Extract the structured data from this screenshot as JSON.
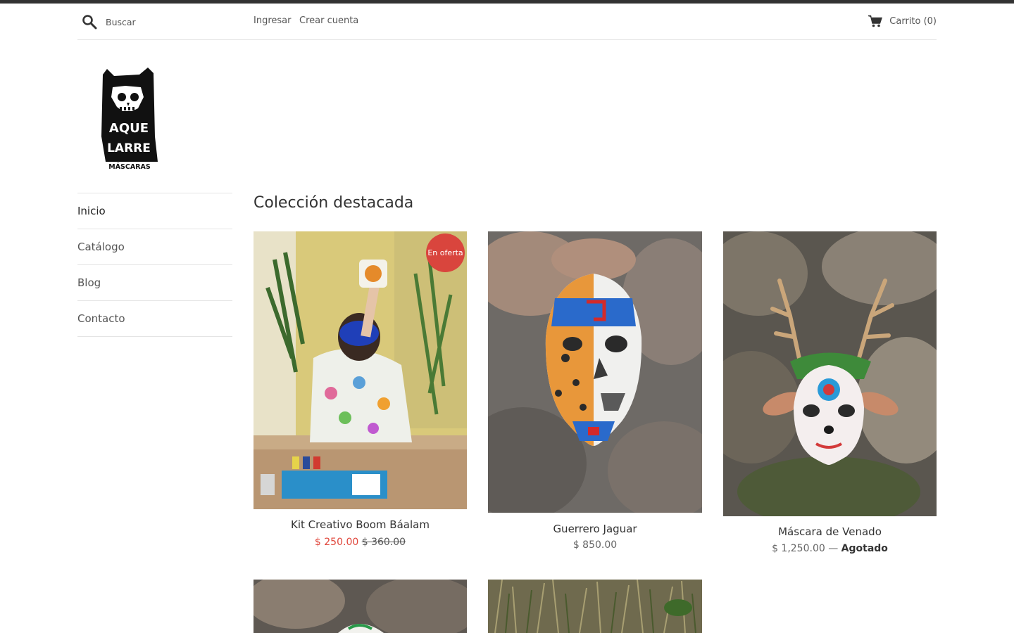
{
  "header": {
    "search_placeholder": "Buscar",
    "login_label": "Ingresar",
    "register_label": "Crear cuenta",
    "cart_label": "Carrito (0)"
  },
  "logo": {
    "icon": "aquelarre-skull-cat-logo",
    "text_line1": "AQUE",
    "text_line2": "LARRE",
    "text_line3": "MÁSCARAS"
  },
  "nav": {
    "items": [
      {
        "label": "Inicio",
        "active": true
      },
      {
        "label": "Catálogo"
      },
      {
        "label": "Blog"
      },
      {
        "label": "Contacto"
      }
    ]
  },
  "collection": {
    "title": "Colección destacada",
    "products": [
      {
        "title": "Kit Creativo Boom Báalam",
        "price": "$ 250.00",
        "compare_price": "$ 360.00",
        "badge": "En oferta"
      },
      {
        "title": "Guerrero Jaguar",
        "price": "$ 850.00"
      },
      {
        "title": "Máscara de Venado",
        "price": "$ 1,250.00",
        "separator": "—",
        "status": "Agotado"
      }
    ]
  },
  "colors": {
    "topbar": "#333333",
    "sale_red": "#e0453a",
    "badge_red": "#d9453d",
    "border": "#e4e4e4"
  }
}
